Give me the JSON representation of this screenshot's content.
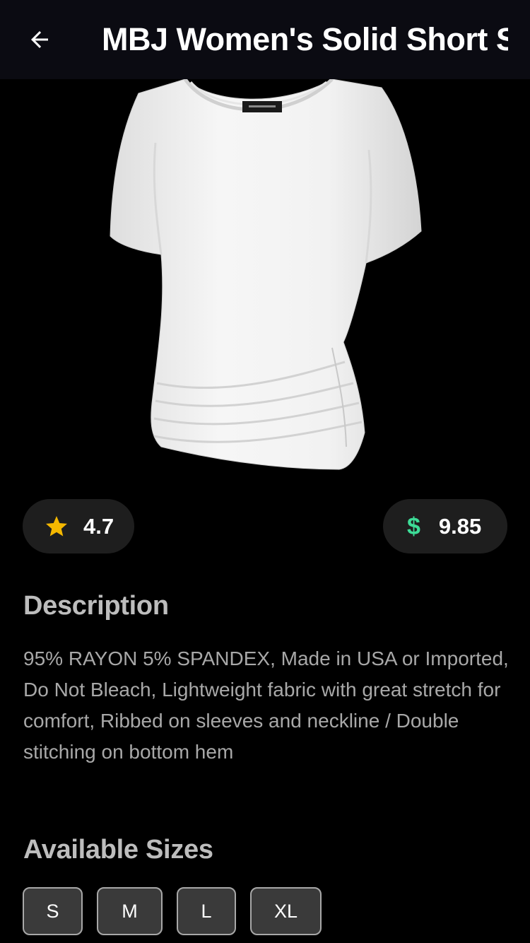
{
  "app_bar": {
    "title": "MBJ Women's Solid Short Sleeve Boat Neck V"
  },
  "product": {
    "rating": "4.7",
    "price_symbol": "$",
    "price": "9.85",
    "description_heading": "Description",
    "description": "95% RAYON 5% SPANDEX, Made in USA or Imported, Do Not Bleach, Lightweight fabric with great stretch for comfort, Ribbed on sleeves and neckline / Double stitching on bottom hem",
    "sizes_heading": "Available Sizes",
    "sizes": [
      "S",
      "M",
      "L",
      "XL"
    ]
  },
  "colors": {
    "star": "#f5b800",
    "price_accent": "#3ddc97",
    "app_bar": "#0b0b12"
  },
  "icons": {
    "back": "arrow-left-icon",
    "rating": "star-icon"
  }
}
